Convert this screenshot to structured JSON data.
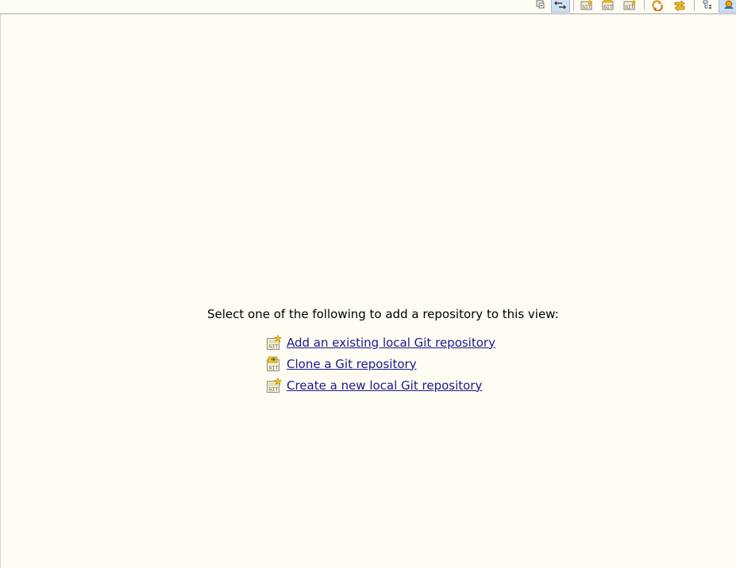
{
  "toolbar": {
    "buttons": [
      {
        "icon": "collapse-all-icon",
        "active": false
      },
      {
        "icon": "link-with-selection-icon",
        "active": true
      },
      {
        "icon": "add-repository-icon",
        "active": false
      },
      {
        "icon": "clone-repository-icon",
        "active": false
      },
      {
        "icon": "create-repository-icon",
        "active": false
      },
      {
        "icon": "refresh-icon",
        "active": false
      },
      {
        "icon": "fetch-icon",
        "active": false
      },
      {
        "icon": "hierarchical-layout-icon",
        "active": false
      },
      {
        "icon": "view-menu-icon",
        "active": true
      }
    ]
  },
  "empty_view": {
    "intro": "Select one of the following to add a repository to this view:",
    "links": [
      {
        "label": "Add an existing local Git repository",
        "icon": "add-git-repository-icon"
      },
      {
        "label": "Clone a Git repository",
        "icon": "clone-git-repository-icon"
      },
      {
        "label": "Create a new local Git repository",
        "icon": "create-git-repository-icon"
      }
    ]
  },
  "colors": {
    "background": "#fffcf4",
    "link": "#1a1a8c",
    "text": "#000000",
    "toolbar_active": "#cfe0f0"
  }
}
